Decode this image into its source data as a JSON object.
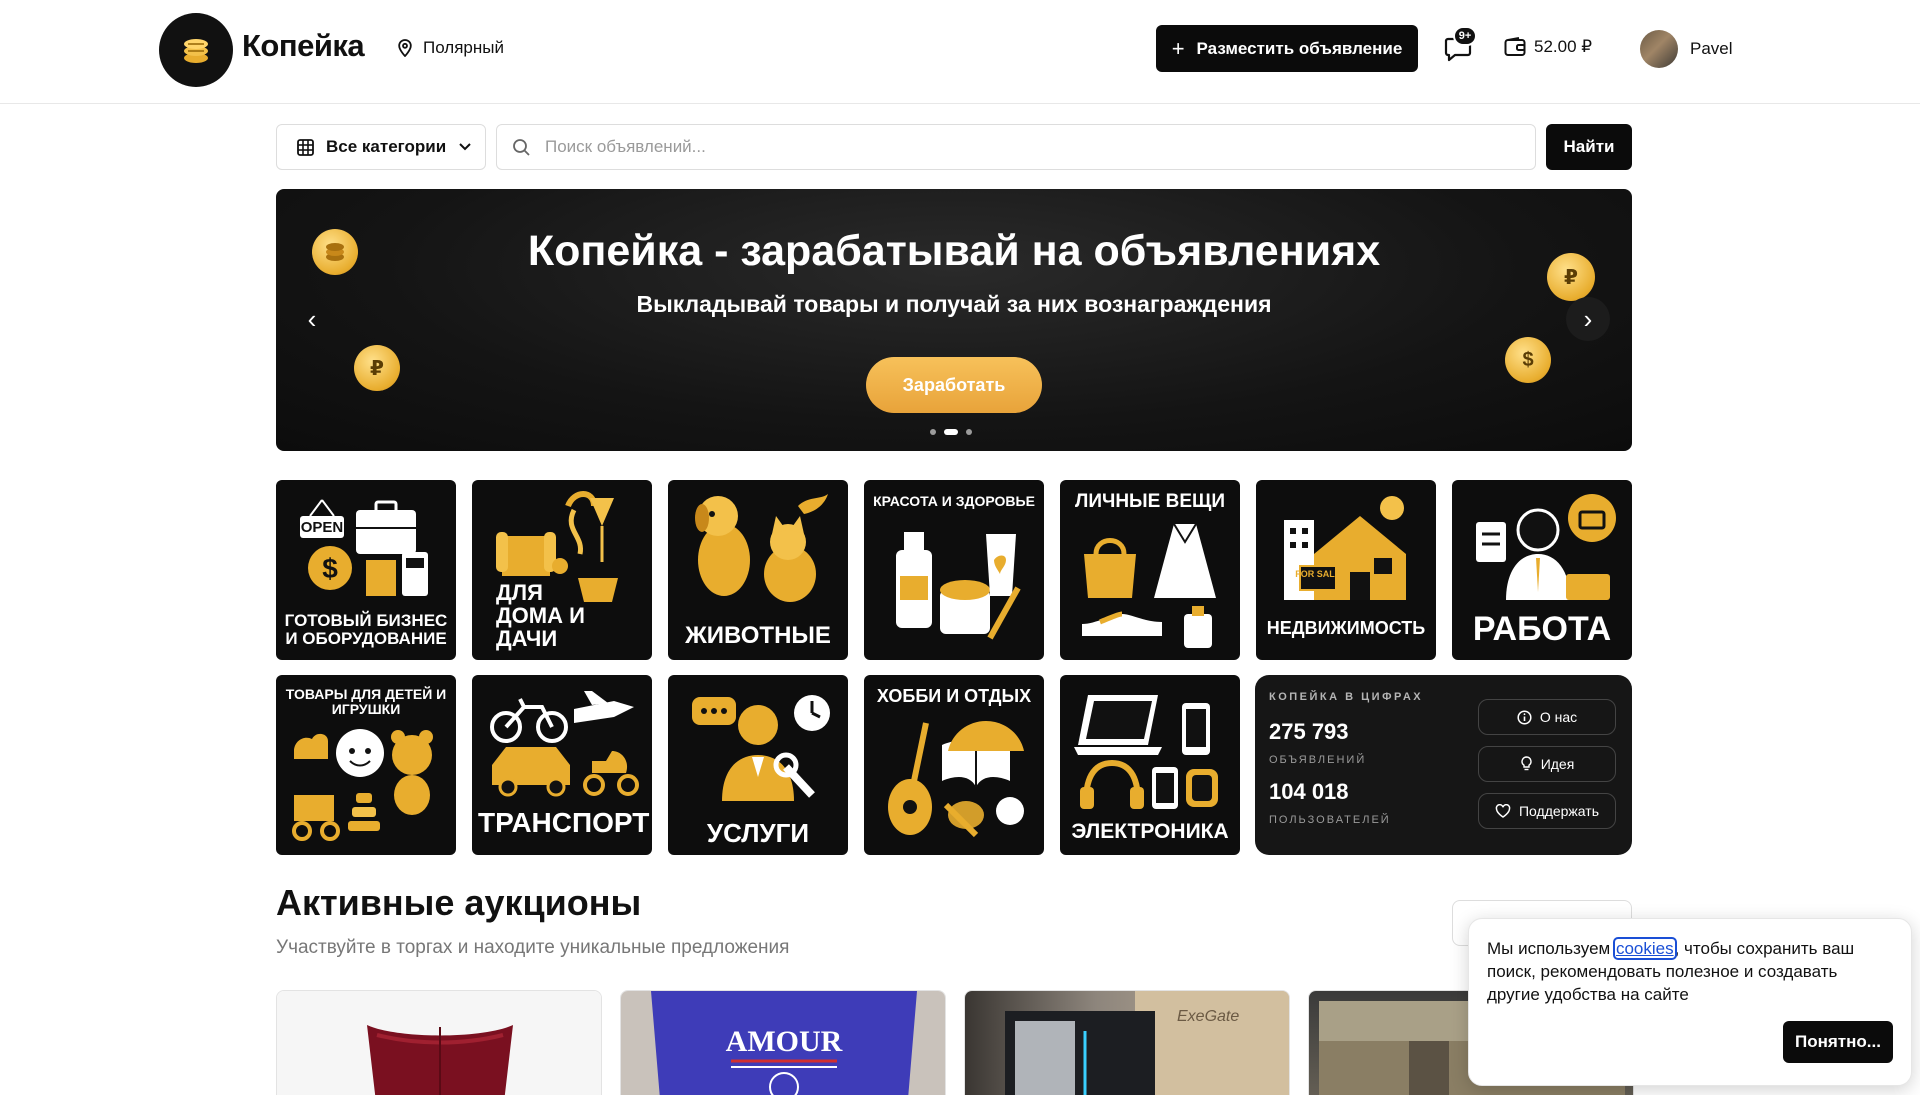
{
  "header": {
    "brand": "Копейка",
    "location": "Полярный",
    "post_button": "Разместить объявление",
    "messages_badge": "9+",
    "balance": "52.00 ₽",
    "user_name": "Pavel"
  },
  "search": {
    "categories_label": "Все категории",
    "placeholder": "Поиск объявлений...",
    "submit_label": "Найти"
  },
  "banner": {
    "title": "Копейка - зарабатывай на объявлениях",
    "subtitle": "Выкладывай товары и получай за них вознаграждения",
    "cta": "Заработать",
    "slides": 3,
    "active_slide": 2,
    "coin_symbols": [
      "₽",
      "₽",
      "$"
    ]
  },
  "categories": [
    {
      "label": "ГОТОВЫЙ БИЗНЕС И ОБОРУДОВАНИЕ",
      "icon": "business-icon",
      "badge": "OPEN"
    },
    {
      "label": "ДЛЯ ДОМА И ДАЧИ",
      "icon": "home-garden-icon"
    },
    {
      "label": "ЖИВОТНЫЕ",
      "icon": "animals-icon"
    },
    {
      "label": "КРАСОТА И ЗДОРОВЬЕ",
      "icon": "beauty-icon"
    },
    {
      "label": "ЛИЧНЫЕ ВЕЩИ",
      "icon": "personal-items-icon"
    },
    {
      "label": "НЕДВИЖИМОСТЬ",
      "icon": "real-estate-icon",
      "badge": "FOR SALE"
    },
    {
      "label": "РАБОТА",
      "icon": "work-icon"
    },
    {
      "label": "ТОВАРЫ ДЛЯ ДЕТЕЙ И ИГРУШКИ",
      "icon": "kids-icon"
    },
    {
      "label": "ТРАНСПОРТ",
      "icon": "transport-icon"
    },
    {
      "label": "УСЛУГИ",
      "icon": "services-icon"
    },
    {
      "label": "ХОББИ И ОТДЫХ",
      "icon": "hobby-icon"
    },
    {
      "label": "ЭЛЕКТРОНИКА",
      "icon": "electronics-icon"
    }
  ],
  "stats": {
    "heading": "КОПЕЙКА В ЦИФРАХ",
    "listings_count": "275 793",
    "listings_label": "ОБЪЯВЛЕНИЙ",
    "users_count": "104 018",
    "users_label": "ПОЛЬЗОВАТЕЛЕЙ",
    "about_button": "О нас",
    "idea_button": "Идея",
    "support_button": "Поддержать"
  },
  "auctions": {
    "title": "Активные аукционы",
    "subtitle": "Участвуйте в торгах и находите уникальные предложения",
    "cards": [
      {
        "image": "red-corset"
      },
      {
        "image": "blue-tshirt",
        "print": "AMOUR"
      },
      {
        "image": "pc-case",
        "print": "ExeGate"
      },
      {
        "image": "game-screen"
      }
    ]
  },
  "cookie": {
    "text_before": "Мы используем ",
    "link": "cookies",
    "text_after": ", чтобы сохранить ваш поиск, рекомендовать полезное и создавать другие удобства на сайте",
    "accept": "Понятно..."
  },
  "colors": {
    "accent_gold": "#e8ad2e",
    "dark": "#0b0b0b",
    "link": "#1a4fd6"
  }
}
